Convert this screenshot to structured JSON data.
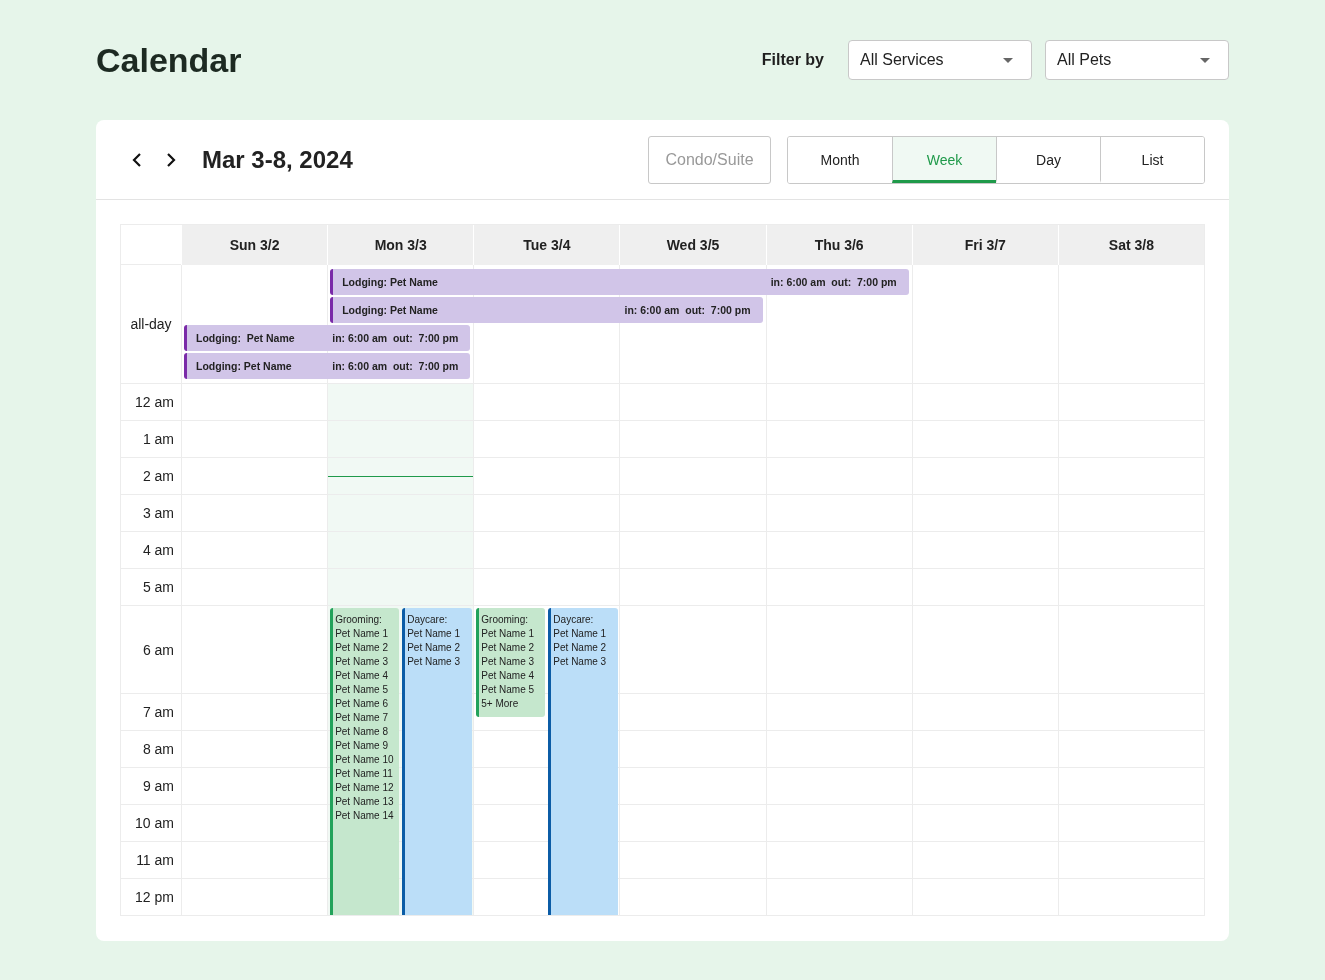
{
  "header": {
    "title": "Calendar",
    "filter_label": "Filter by",
    "filters": [
      {
        "value": "All Services"
      },
      {
        "value": "All Pets"
      }
    ]
  },
  "toolbar": {
    "range": "Mar 3-8, 2024",
    "resource_toggle": {
      "label": "Condo/Suite",
      "disabled": true
    },
    "views": [
      {
        "label": "Month",
        "selected": false
      },
      {
        "label": "Week",
        "selected": true
      },
      {
        "label": "Day",
        "selected": false
      },
      {
        "label": "List",
        "selected": false
      }
    ]
  },
  "calendar": {
    "days": [
      {
        "label": "Sun 3/2",
        "today": false
      },
      {
        "label": "Mon 3/3",
        "today": true,
        "events": [
          {
            "kind": "grooming",
            "continues": true,
            "title": "Grooming:",
            "pets": [
              "Pet Name 1",
              "Pet Name 2",
              "Pet Name 3",
              "Pet Name 4",
              "Pet Name 5",
              "Pet Name 6",
              "Pet Name 7",
              "Pet Name 8",
              "Pet Name 9",
              "Pet Name 10",
              "Pet Name 11",
              "Pet Name 12",
              "Pet Name 13",
              "Pet Name 14"
            ]
          },
          {
            "kind": "daycare",
            "continues": true,
            "title": "Daycare:",
            "pets": [
              "Pet Name 1",
              "Pet Name 2",
              "Pet Name 3"
            ]
          }
        ]
      },
      {
        "label": "Tue 3/4",
        "today": false,
        "events": [
          {
            "kind": "grooming",
            "continues": false,
            "title": "Grooming:",
            "pets": [
              "Pet Name 1",
              "Pet Name 2",
              "Pet Name 3",
              "Pet Name 4",
              "Pet Name 5"
            ],
            "more": "5+ More"
          },
          {
            "kind": "daycare",
            "continues": true,
            "title": "Daycare:",
            "pets": [
              "Pet Name 1",
              "Pet Name 2",
              "Pet Name 3"
            ]
          }
        ]
      },
      {
        "label": "Wed 3/5",
        "today": false
      },
      {
        "label": "Thu 3/6",
        "today": false
      },
      {
        "label": "Fri 3/7",
        "today": false
      },
      {
        "label": "Sat 3/8",
        "today": false
      }
    ],
    "all_day_label": "all-day",
    "all_day_events": [
      {
        "kind": "lodging",
        "title": "Lodging: Pet Name",
        "times": "in: 6:00 am  out:  7:00 pm"
      },
      {
        "kind": "lodging",
        "title": "Lodging: Pet Name",
        "times": "in: 6:00 am  out:  7:00 pm"
      },
      {
        "kind": "lodging",
        "title": "Lodging:  Pet Name",
        "times": "in: 6:00 am  out:  7:00 pm"
      },
      {
        "kind": "lodging",
        "title": "Lodging: Pet Name",
        "times": "in: 6:00 am  out:  7:00 pm"
      }
    ],
    "hours": [
      {
        "label": "12 am",
        "now": false,
        "events_start": false
      },
      {
        "label": "1 am",
        "now": false,
        "events_start": false
      },
      {
        "label": "2 am",
        "now": true,
        "events_start": false
      },
      {
        "label": "3 am",
        "now": false,
        "events_start": false
      },
      {
        "label": "4 am",
        "now": false,
        "events_start": false
      },
      {
        "label": "5 am",
        "now": false,
        "events_start": false
      },
      {
        "label": "6 am",
        "now": false,
        "events_start": true
      },
      {
        "label": "7 am",
        "now": false,
        "events_start": false
      },
      {
        "label": "8 am",
        "now": false,
        "events_start": false
      },
      {
        "label": "9 am",
        "now": false,
        "events_start": false
      },
      {
        "label": "10 am",
        "now": false,
        "events_start": false
      },
      {
        "label": "11 am",
        "now": false,
        "events_start": false
      },
      {
        "label": "12 pm",
        "now": false,
        "events_start": false
      }
    ]
  }
}
